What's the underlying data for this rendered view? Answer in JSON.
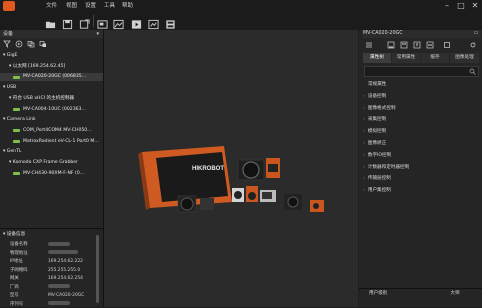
{
  "menu": {
    "items": [
      "文件",
      "视图",
      "设置",
      "工具",
      "帮助"
    ]
  },
  "window_controls": {
    "minimize": "–",
    "maximize": "□",
    "close": "✕"
  },
  "toolbar": {
    "icons": [
      "folder-open-icon",
      "save-icon",
      "save-as-icon",
      "snapshot-icon",
      "image-icon",
      "video-icon",
      "chart-icon",
      "table-icon"
    ]
  },
  "left_panel": {
    "title": "设备",
    "collapse": "▾",
    "tree": [
      {
        "kind": "group",
        "label": "GigE"
      },
      {
        "kind": "group2",
        "label": "以太网 [169.254.62.45]"
      },
      {
        "kind": "device",
        "label": "MV-CA020-20GC (006835...",
        "selected": true
      },
      {
        "kind": "group",
        "label": "USB"
      },
      {
        "kind": "group2",
        "label": "符合 USB xHCI 的主机控制器"
      },
      {
        "kind": "device",
        "label": "MV-CA004-10UC (002363..."
      },
      {
        "kind": "group",
        "label": "Camera Link"
      },
      {
        "kind": "device",
        "label": "COM_Port4COM4 MV-CH050..."
      },
      {
        "kind": "device",
        "label": "MatroxRadient eV-CL-1 Port0 M..."
      },
      {
        "kind": "group",
        "label": "GenTL"
      },
      {
        "kind": "group2",
        "label": "Komodo CXP Frame Grabber"
      },
      {
        "kind": "device",
        "label": "MV-CH430-90XM-F-NF (0..."
      }
    ],
    "info_title": "设备信息",
    "info": [
      {
        "key": "设备名称",
        "value": ""
      },
      {
        "key": "物理地址",
        "value": ""
      },
      {
        "key": "IP地址",
        "value": "169.254.62.222"
      },
      {
        "key": "子网掩码",
        "value": "255.255.255.0"
      },
      {
        "key": "网关",
        "value": "169.254.62.254"
      },
      {
        "key": "厂商",
        "value": ""
      },
      {
        "key": "型号",
        "value": "MV-CA020-20GC"
      },
      {
        "key": "序列号",
        "value": ""
      }
    ]
  },
  "center": {
    "brand": "HIKROBOT"
  },
  "right_panel": {
    "title": "MV-CA020-20GC",
    "tabs": [
      "属性树",
      "常用属性",
      "缓存",
      "图像处理"
    ],
    "items": [
      "常规属性",
      "设备控制",
      "图像格式控制",
      "采集控制",
      "模拟控制",
      "图像矫正",
      "数字IO控制",
      "计数器和定时器控制",
      "传输层控制",
      "用户集控制"
    ],
    "footer_left": "用户级别",
    "footer_right": "大师"
  },
  "colors": {
    "accent": "#e0581d",
    "device_green": "#7ec24b",
    "panel": "#252526",
    "center": "#2b2b2b"
  }
}
